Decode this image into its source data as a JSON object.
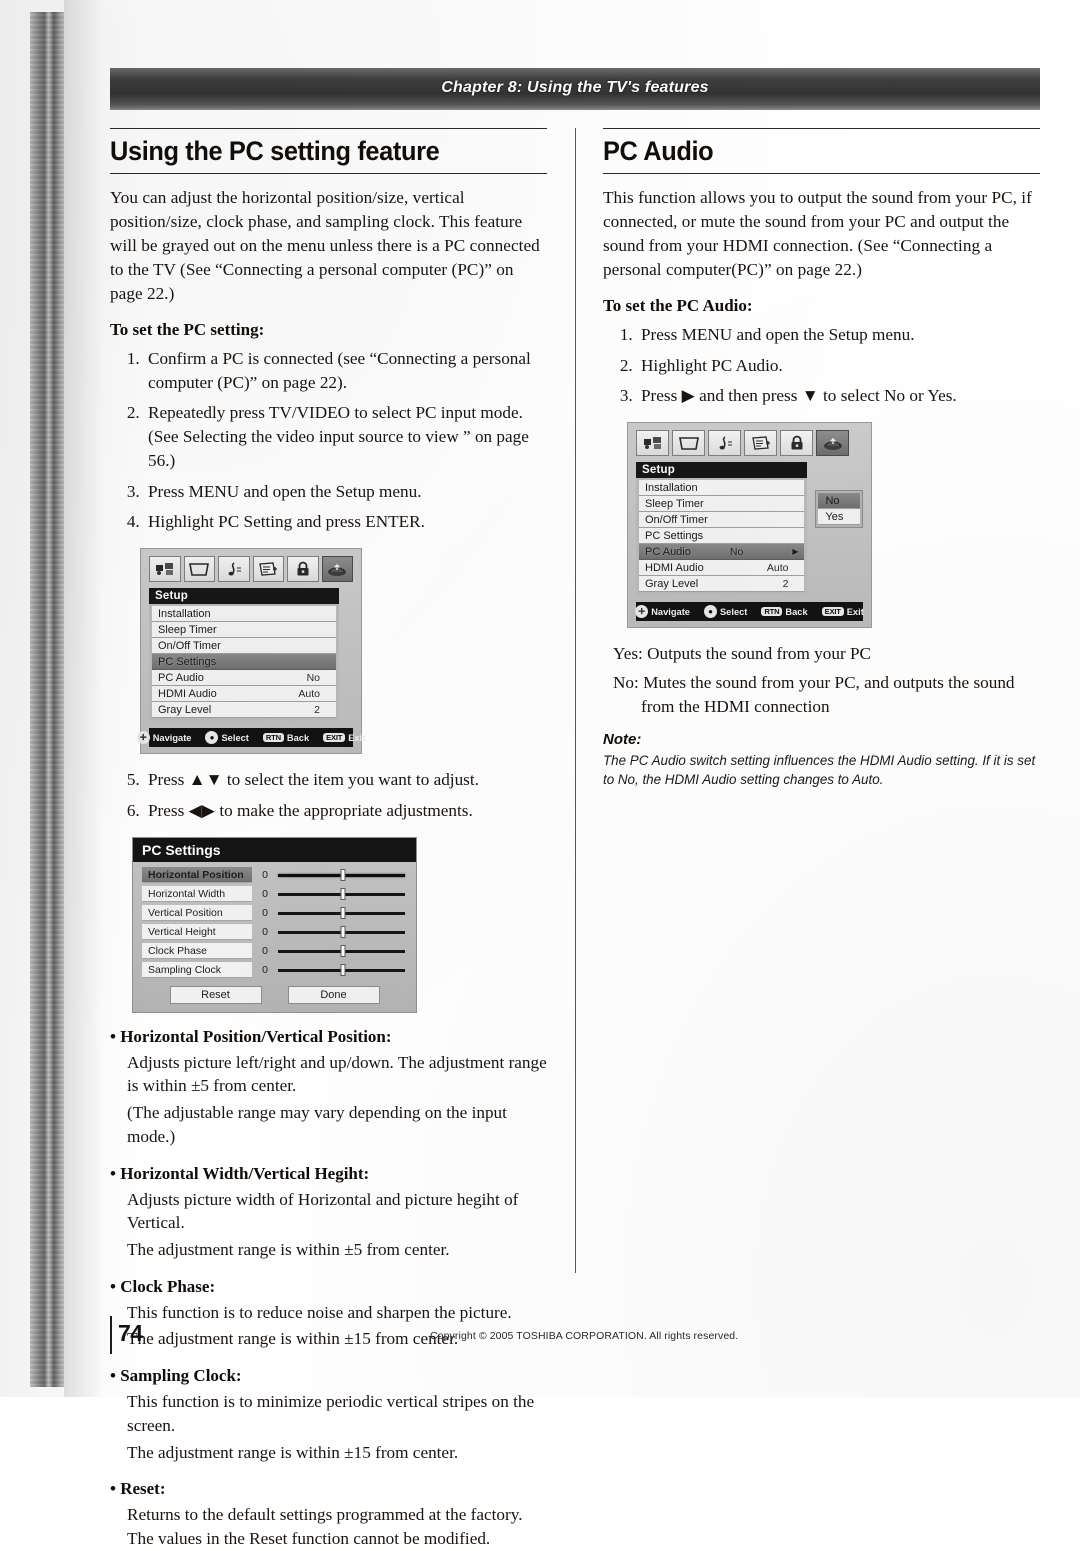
{
  "header": {
    "chapter": "Chapter 8: Using the TV's features"
  },
  "footer": {
    "page_number": "74",
    "copyright": "Copyright © 2005 TOSHIBA CORPORATION. All rights reserved."
  },
  "left_column": {
    "heading": "Using the PC setting feature",
    "lead": "You can adjust the horizontal position/size, vertical position/size, clock phase, and sampling clock. This feature will be grayed out on the menu unless there is a PC connected to the TV (See “Connecting a personal computer (PC)” on page 22.)",
    "subhead": "To set the PC setting:",
    "steps": [
      "Confirm a PC is connected (see “Connecting a personal computer (PC)” on page 22).",
      "Repeatedly press TV/VIDEO to select PC input mode. (See Selecting the video input source to view ” on page 56.)",
      "Press MENU and open the Setup menu.",
      "Highlight PC Setting and press ENTER."
    ],
    "steps_after": [
      "Press ▲▼ to select the item you want to adjust.",
      "Press ◀▶ to make the appropriate adjustments."
    ],
    "definitions": [
      {
        "term": "Horizontal Position/Vertical Position:",
        "lines": [
          "Adjusts picture left/right and up/down. The adjustment range is within ±5 from center.",
          "(The adjustable range may vary depending on the input mode.)"
        ]
      },
      {
        "term": "Horizontal Width/Vertical Hegiht:",
        "lines": [
          "Adjusts picture width of Horizontal and picture hegiht of Vertical.",
          "The adjustment range is within ±5 from center."
        ]
      },
      {
        "term": "Clock Phase:",
        "lines": [
          "This function is to reduce noise and sharpen the picture.",
          "The adjustment range is within ±15 from center."
        ]
      },
      {
        "term": "Sampling Clock:",
        "lines": [
          "This function is to minimize periodic vertical stripes on the screen.",
          "The adjustment range is within ±15 from center."
        ]
      },
      {
        "term": "Reset:",
        "lines": [
          "Returns to the default settings programmed at the factory. The values in the Reset function cannot be modified."
        ]
      }
    ]
  },
  "right_column": {
    "heading": "PC Audio",
    "lead": "This function allows you to output the sound from your PC, if connected, or mute the sound from your PC and output the sound from your HDMI connection. (See “Connecting a personal computer(PC)” on page 22.)",
    "subhead": "To set the PC Audio:",
    "steps": [
      "Press MENU and open the Setup menu.",
      "Highlight PC Audio.",
      "Press ▶ and then press ▼ to select No or Yes."
    ],
    "yes_line": "Yes: Outputs the sound from your PC",
    "no_line": "No: Mutes the sound from your PC, and outputs the sound",
    "no_line_cont": "from the HDMI connection",
    "note_head": "Note:",
    "note_body": "The PC Audio switch setting influences the HDMI Audio setting. If it is set to No, the HDMI Audio setting changes to Auto."
  },
  "osd_left": {
    "menu_title": "Setup",
    "rows": [
      {
        "label": "Installation",
        "value": "",
        "highlighted": false
      },
      {
        "label": "Sleep Timer",
        "value": "",
        "highlighted": false
      },
      {
        "label": "On/Off Timer",
        "value": "",
        "highlighted": false
      },
      {
        "label": "PC Settings",
        "value": "",
        "highlighted": true
      },
      {
        "label": "PC Audio",
        "value": "No",
        "highlighted": false
      },
      {
        "label": "HDMI Audio",
        "value": "Auto",
        "highlighted": false
      },
      {
        "label": "Gray Level",
        "value": "2",
        "highlighted": false
      }
    ],
    "nav": [
      {
        "key": "✛",
        "label": "Navigate",
        "type": "round"
      },
      {
        "key": "●",
        "label": "Select",
        "type": "round"
      },
      {
        "key": "RTN",
        "label": "Back",
        "type": "pill"
      },
      {
        "key": "EXIT",
        "label": "Exit",
        "type": "pill"
      }
    ],
    "icons": [
      "antenna-icon",
      "screen-icon",
      "music-note-icon",
      "list-settings-icon",
      "lock-icon",
      "setup-wrench-icon"
    ]
  },
  "osd_right": {
    "menu_title": "Setup",
    "rows": [
      {
        "label": "Installation",
        "value": "",
        "highlighted": false
      },
      {
        "label": "Sleep Timer",
        "value": "",
        "highlighted": false
      },
      {
        "label": "On/Off Timer",
        "value": "",
        "highlighted": false
      },
      {
        "label": "PC Settings",
        "value": "",
        "highlighted": false
      },
      {
        "label": "PC Audio",
        "value": "No",
        "highlighted": true
      },
      {
        "label": "HDMI Audio",
        "value": "Auto",
        "highlighted": false
      },
      {
        "label": "Gray Level",
        "value": "2",
        "highlighted": false
      }
    ],
    "popup": [
      {
        "label": "No",
        "highlighted": true
      },
      {
        "label": "Yes",
        "highlighted": false
      }
    ],
    "nav": [
      {
        "key": "✛",
        "label": "Navigate",
        "type": "round"
      },
      {
        "key": "●",
        "label": "Select",
        "type": "round"
      },
      {
        "key": "RTN",
        "label": "Back",
        "type": "pill"
      },
      {
        "key": "EXIT",
        "label": "Exit",
        "type": "pill"
      }
    ],
    "icons": [
      "antenna-icon",
      "screen-icon",
      "music-note-icon",
      "list-settings-icon",
      "lock-icon",
      "setup-wrench-icon"
    ]
  },
  "pc_settings_dialog": {
    "title": "PC Settings",
    "rows": [
      {
        "label": "Horizontal Position",
        "value": "0",
        "highlighted": true
      },
      {
        "label": "Horizontal Width",
        "value": "0",
        "highlighted": false
      },
      {
        "label": "Vertical Position",
        "value": "0",
        "highlighted": false
      },
      {
        "label": "Vertical Height",
        "value": "0",
        "highlighted": false
      },
      {
        "label": "Clock Phase",
        "value": "0",
        "highlighted": false
      },
      {
        "label": "Sampling Clock",
        "value": "0",
        "highlighted": false
      }
    ],
    "buttons": [
      "Reset",
      "Done"
    ]
  }
}
